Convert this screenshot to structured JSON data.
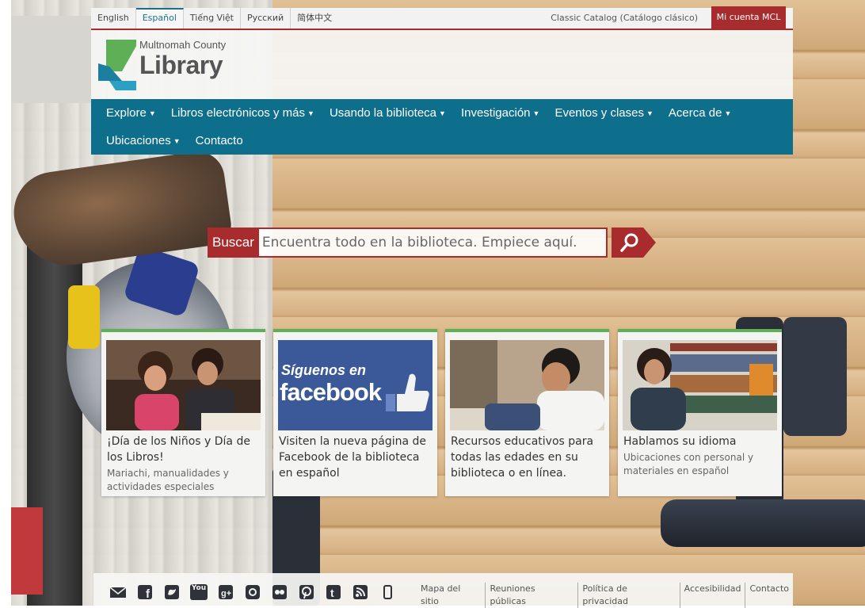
{
  "languages": [
    "English",
    "Español",
    "Tiếng Việt",
    "Русский",
    "简体中文"
  ],
  "active_language": "Español",
  "classic_catalog": "Classic Catalog (Catálogo clásico)",
  "my_account": "Mi cuenta MCL",
  "logo": {
    "county": "Multnomah County",
    "library": "Library"
  },
  "nav": {
    "row1": [
      "Explore",
      "Libros electrónicos y más",
      "Usando la biblioteca",
      "Investigación",
      "Eventos y clases",
      "Acerca de"
    ],
    "row2": [
      "Ubicaciones",
      "Contacto"
    ],
    "row2_has_chevron": [
      true,
      false
    ]
  },
  "search": {
    "label": "Buscar",
    "placeholder": "Encuentra todo en la biblioteca. Empiece aquí."
  },
  "cards": [
    {
      "title": "¡Día de los Niños y Día de los Libros!",
      "subtitle": "Mariachi, manualidades y actividades especiales"
    },
    {
      "title": "Visiten la nueva página de Facebook de la biblioteca en español",
      "subtitle": "",
      "badge_line1": "Síguenos en",
      "badge_line2": "facebook"
    },
    {
      "title": "Recursos educativos para todas las edades en su biblioteca o en línea.",
      "subtitle": ""
    },
    {
      "title": "Hablamos su idioma",
      "subtitle": "Ubicaciones con personal y materiales en español"
    }
  ],
  "footer": {
    "social_icons": [
      "email-icon",
      "facebook-icon",
      "twitter-icon",
      "youtube-icon",
      "google-plus-icon",
      "instagram-icon",
      "flickr-icon",
      "pinterest-icon",
      "tumblr-icon",
      "rss-icon",
      "mobile-icon"
    ],
    "youtube_glyph": "You",
    "links": [
      "Mapa del sitio",
      "Reuniones públicas",
      "Política de privacidad",
      "Accesibilidad",
      "Contacto"
    ]
  },
  "colors": {
    "brand_red": "#a82c2e",
    "nav_teal": "#0e6f8d",
    "card_accent": "#5eaf55"
  }
}
